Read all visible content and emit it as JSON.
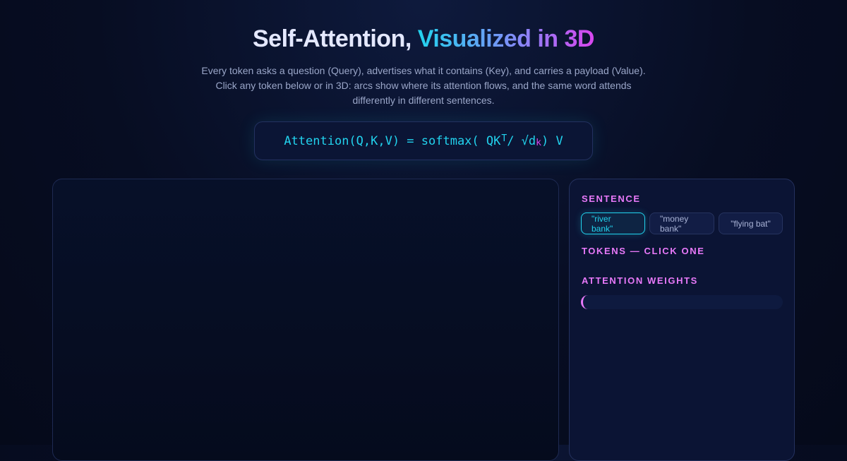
{
  "header": {
    "title_plain": "Self-Attention,",
    "title_gradient": "Visualized in 3D",
    "subtitle_line1": "Every token asks a question (Query), advertises what it contains (Key), and carries a payload (Value).",
    "subtitle_line2": "Click any token below or in 3D: arcs show where its attention flows, and the same word attends",
    "subtitle_line3": "differently in different sentences."
  },
  "formula": {
    "prefix": "Attention(Q,K,V) = softmax( QK",
    "superscript": "T",
    "middle": " / √d",
    "subscript": "k",
    "suffix": " ) V"
  },
  "panel": {
    "sentence_label": "SENTENCE",
    "tokens_label": "TOKENS — CLICK ONE",
    "weights_label": "ATTENTION WEIGHTS",
    "sentences": [
      {
        "label": "\"river bank\"",
        "active": true
      },
      {
        "label": "\"money bank\"",
        "active": false
      },
      {
        "label": "\"flying bat\"",
        "active": false
      }
    ]
  },
  "colors": {
    "accent_cyan": "#22d3ee",
    "accent_magenta": "#e879f9",
    "accent_violet": "#818cf8"
  }
}
